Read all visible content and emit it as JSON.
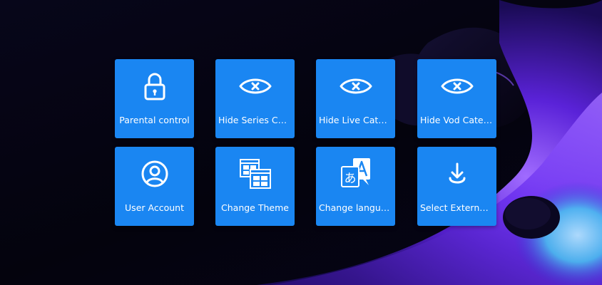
{
  "settings_menu": {
    "tiles": [
      {
        "label": "Parental control",
        "icon": "lock-icon"
      },
      {
        "label": "Hide Series Cate…",
        "icon": "eye-hidden-icon"
      },
      {
        "label": "Hide Live Categ…",
        "icon": "eye-hidden-icon"
      },
      {
        "label": "Hide Vod Categ…",
        "icon": "eye-hidden-icon"
      },
      {
        "label": "User Account",
        "icon": "user-account-icon"
      },
      {
        "label": "Change Theme",
        "icon": "theme-icon"
      },
      {
        "label": "Change language",
        "icon": "language-icon"
      },
      {
        "label": "Select External P…",
        "icon": "download-icon"
      }
    ]
  },
  "colors": {
    "tile": "#1a86f2",
    "background": "#05040f",
    "accent_purple": "#7a3cff",
    "accent_cyan": "#5fe3ff"
  }
}
